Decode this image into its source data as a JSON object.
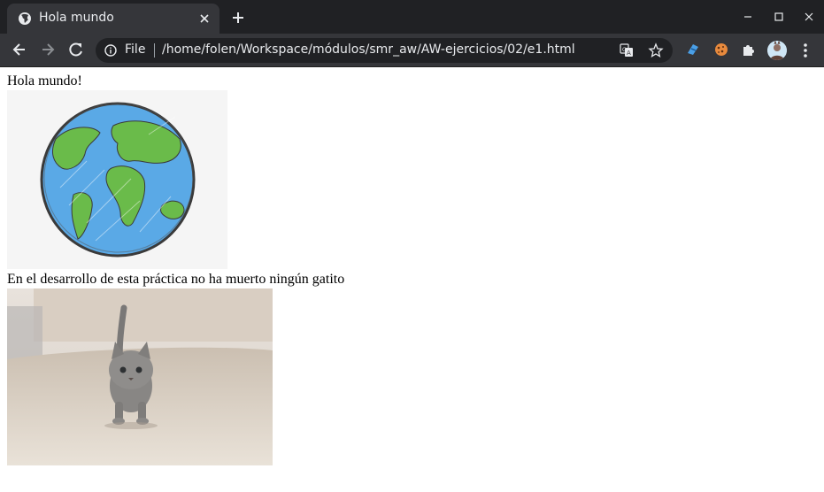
{
  "browser": {
    "tab_title": "Hola mundo",
    "address": {
      "scheme_label": "File",
      "url": "/home/folen/Workspace/módulos/smr_aw/AW-ejercicios/02/e1.html"
    },
    "icons": {
      "favicon": "globe-icon",
      "tab_close": "close-icon",
      "new_tab": "plus-icon",
      "back": "arrow-left-icon",
      "forward": "arrow-right-icon",
      "reload": "reload-icon",
      "info": "info-icon",
      "translate": "translate-icon",
      "bookmark": "star-icon",
      "extensions": "puzzle-icon",
      "menu": "kebab-menu-icon"
    },
    "colors": {
      "tabstrip": "#202124",
      "toolbar": "#35363a",
      "omnibox": "#202124",
      "text": "#e8eaed"
    }
  },
  "page": {
    "heading": "Hola mundo!",
    "caption": "En el desarrollo de esta práctica no ha muerto ningún gatito"
  }
}
